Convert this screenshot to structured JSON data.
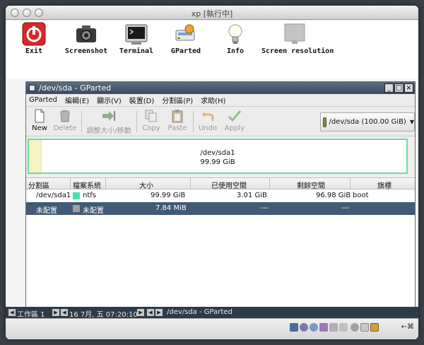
{
  "window": {
    "title": "xp [執行中]"
  },
  "launchers": [
    {
      "label": "Exit",
      "icon": "power-icon"
    },
    {
      "label": "Screenshot",
      "icon": "camera-icon"
    },
    {
      "label": "Terminal",
      "icon": "terminal-icon"
    },
    {
      "label": "GParted",
      "icon": "gparted-icon"
    },
    {
      "label": "Info",
      "icon": "lightbulb-icon"
    },
    {
      "label": "Screen resolution",
      "icon": "monitor-icon"
    }
  ],
  "gparted": {
    "title": "/dev/sda - GParted",
    "menu": [
      "GParted",
      "編輯(E)",
      "顯示(V)",
      "裝置(D)",
      "分割區(P)",
      "求助(H)"
    ],
    "toolbar": {
      "new": "New",
      "delete": "Delete",
      "resize": "調整大小/移動",
      "copy": "Copy",
      "paste": "Paste",
      "undo": "Undo",
      "apply": "Apply"
    },
    "device": "/dev/sda  (100.00 GiB)",
    "diskmap": {
      "name": "/dev/sda1",
      "size": "99.99 GiB"
    },
    "columns": [
      "分割區",
      "檔案系統",
      "大小",
      "已使用空間",
      "剩餘空間",
      "旗標"
    ],
    "rows": [
      {
        "partition": "/dev/sda1",
        "fs": "ntfs",
        "size": "99.99 GiB",
        "used": "3.01 GiB",
        "unused": "96.98 GiB",
        "flags": "boot",
        "color": "#42e5ac"
      },
      {
        "partition": "未配置",
        "fs": "未配置",
        "size": "7.84 MiB",
        "used": "---",
        "unused": "---",
        "flags": "",
        "color": "#a0a0a0"
      }
    ]
  },
  "taskbar": {
    "workspace": "工作區 1",
    "clock": "16 7月, 五 07:20:10",
    "task": "/dev/sda - GParted"
  },
  "statusbar": {
    "hostkey": "←⌘"
  }
}
